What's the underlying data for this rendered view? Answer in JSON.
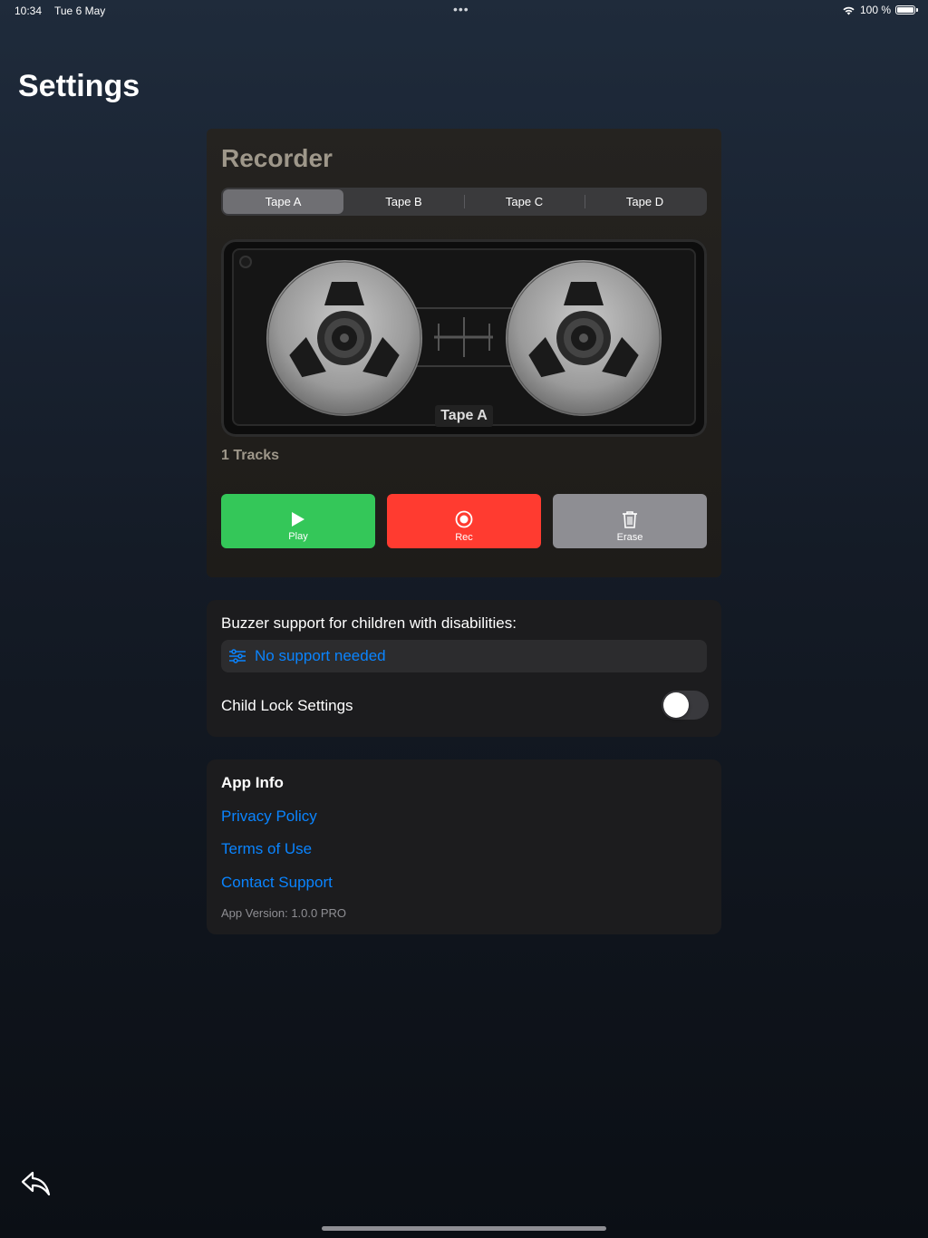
{
  "status": {
    "time": "10:34",
    "date": "Tue 6 May",
    "battery": "100 %"
  },
  "page": {
    "title": "Settings"
  },
  "recorder": {
    "title": "Recorder",
    "tabs": [
      "Tape A",
      "Tape B",
      "Tape C",
      "Tape D"
    ],
    "selected_tab": "Tape A",
    "cassette_label": "Tape A",
    "tracks": "1 Tracks",
    "controls": {
      "play": "Play",
      "rec": "Rec",
      "erase": "Erase"
    },
    "colors": {
      "play": "#34c759",
      "rec": "#ff3b30",
      "erase": "#8e8e93"
    }
  },
  "support": {
    "title": "Buzzer support for children with disabilities:",
    "picker_value": "No support needed",
    "child_lock_label": "Child Lock Settings",
    "child_lock_enabled": false
  },
  "app_info": {
    "title": "App Info",
    "links": [
      "Privacy Policy",
      "Terms of Use",
      "Contact Support"
    ],
    "version": "App Version: 1.0.0 PRO"
  },
  "icons": {
    "wifi": "wifi-icon",
    "battery": "battery-icon",
    "play": "play-icon",
    "rec": "record-icon",
    "erase": "trash-icon",
    "picker": "sliders-icon",
    "back": "back-arrow-icon"
  },
  "accent_color": "#0a84ff"
}
